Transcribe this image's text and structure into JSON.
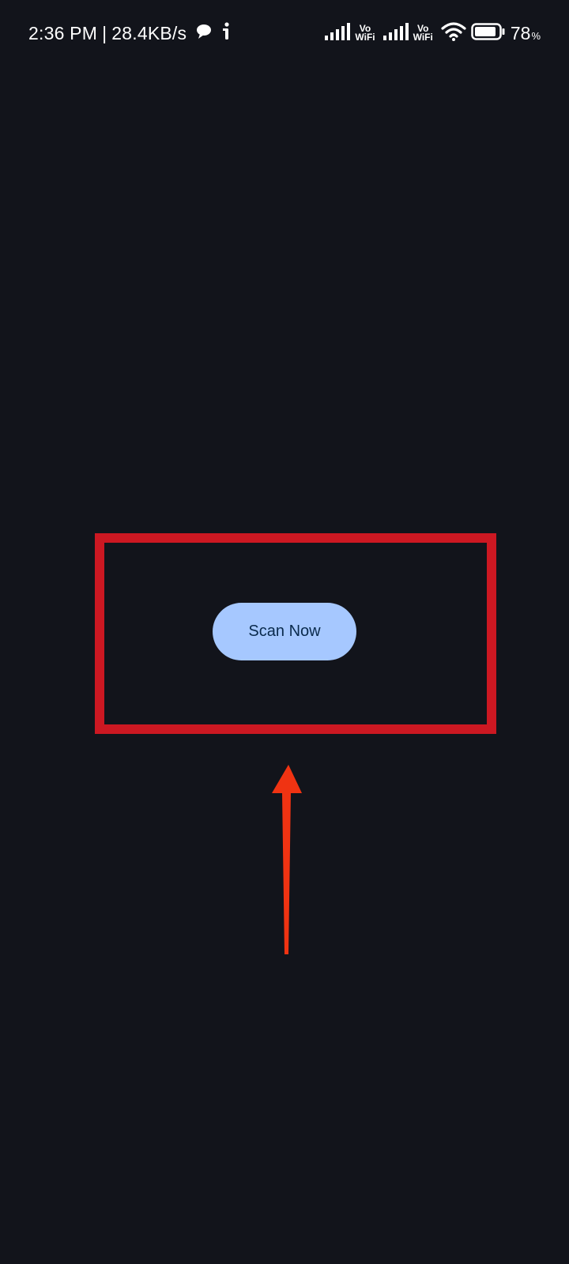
{
  "status_bar": {
    "time": "2:36 PM",
    "separator": "|",
    "network_speed": "28.4KB/s",
    "vowifi_1": {
      "top": "Vo",
      "bottom": "WiFi"
    },
    "vowifi_2": {
      "top": "Vo",
      "bottom": "WiFi"
    },
    "battery_percent": "78",
    "battery_unit": "%",
    "icons": [
      "message-icon",
      "info-icon",
      "signal-icon",
      "signal-icon",
      "wifi-icon",
      "battery-icon"
    ]
  },
  "main": {
    "scan_button_label": "Scan Now"
  },
  "annotation": {
    "box_color": "#cc1822",
    "arrow_color": "#f03312"
  },
  "colors": {
    "background": "#12141b",
    "button_bg": "#a6c8ff",
    "button_text": "#0a2a4c"
  }
}
